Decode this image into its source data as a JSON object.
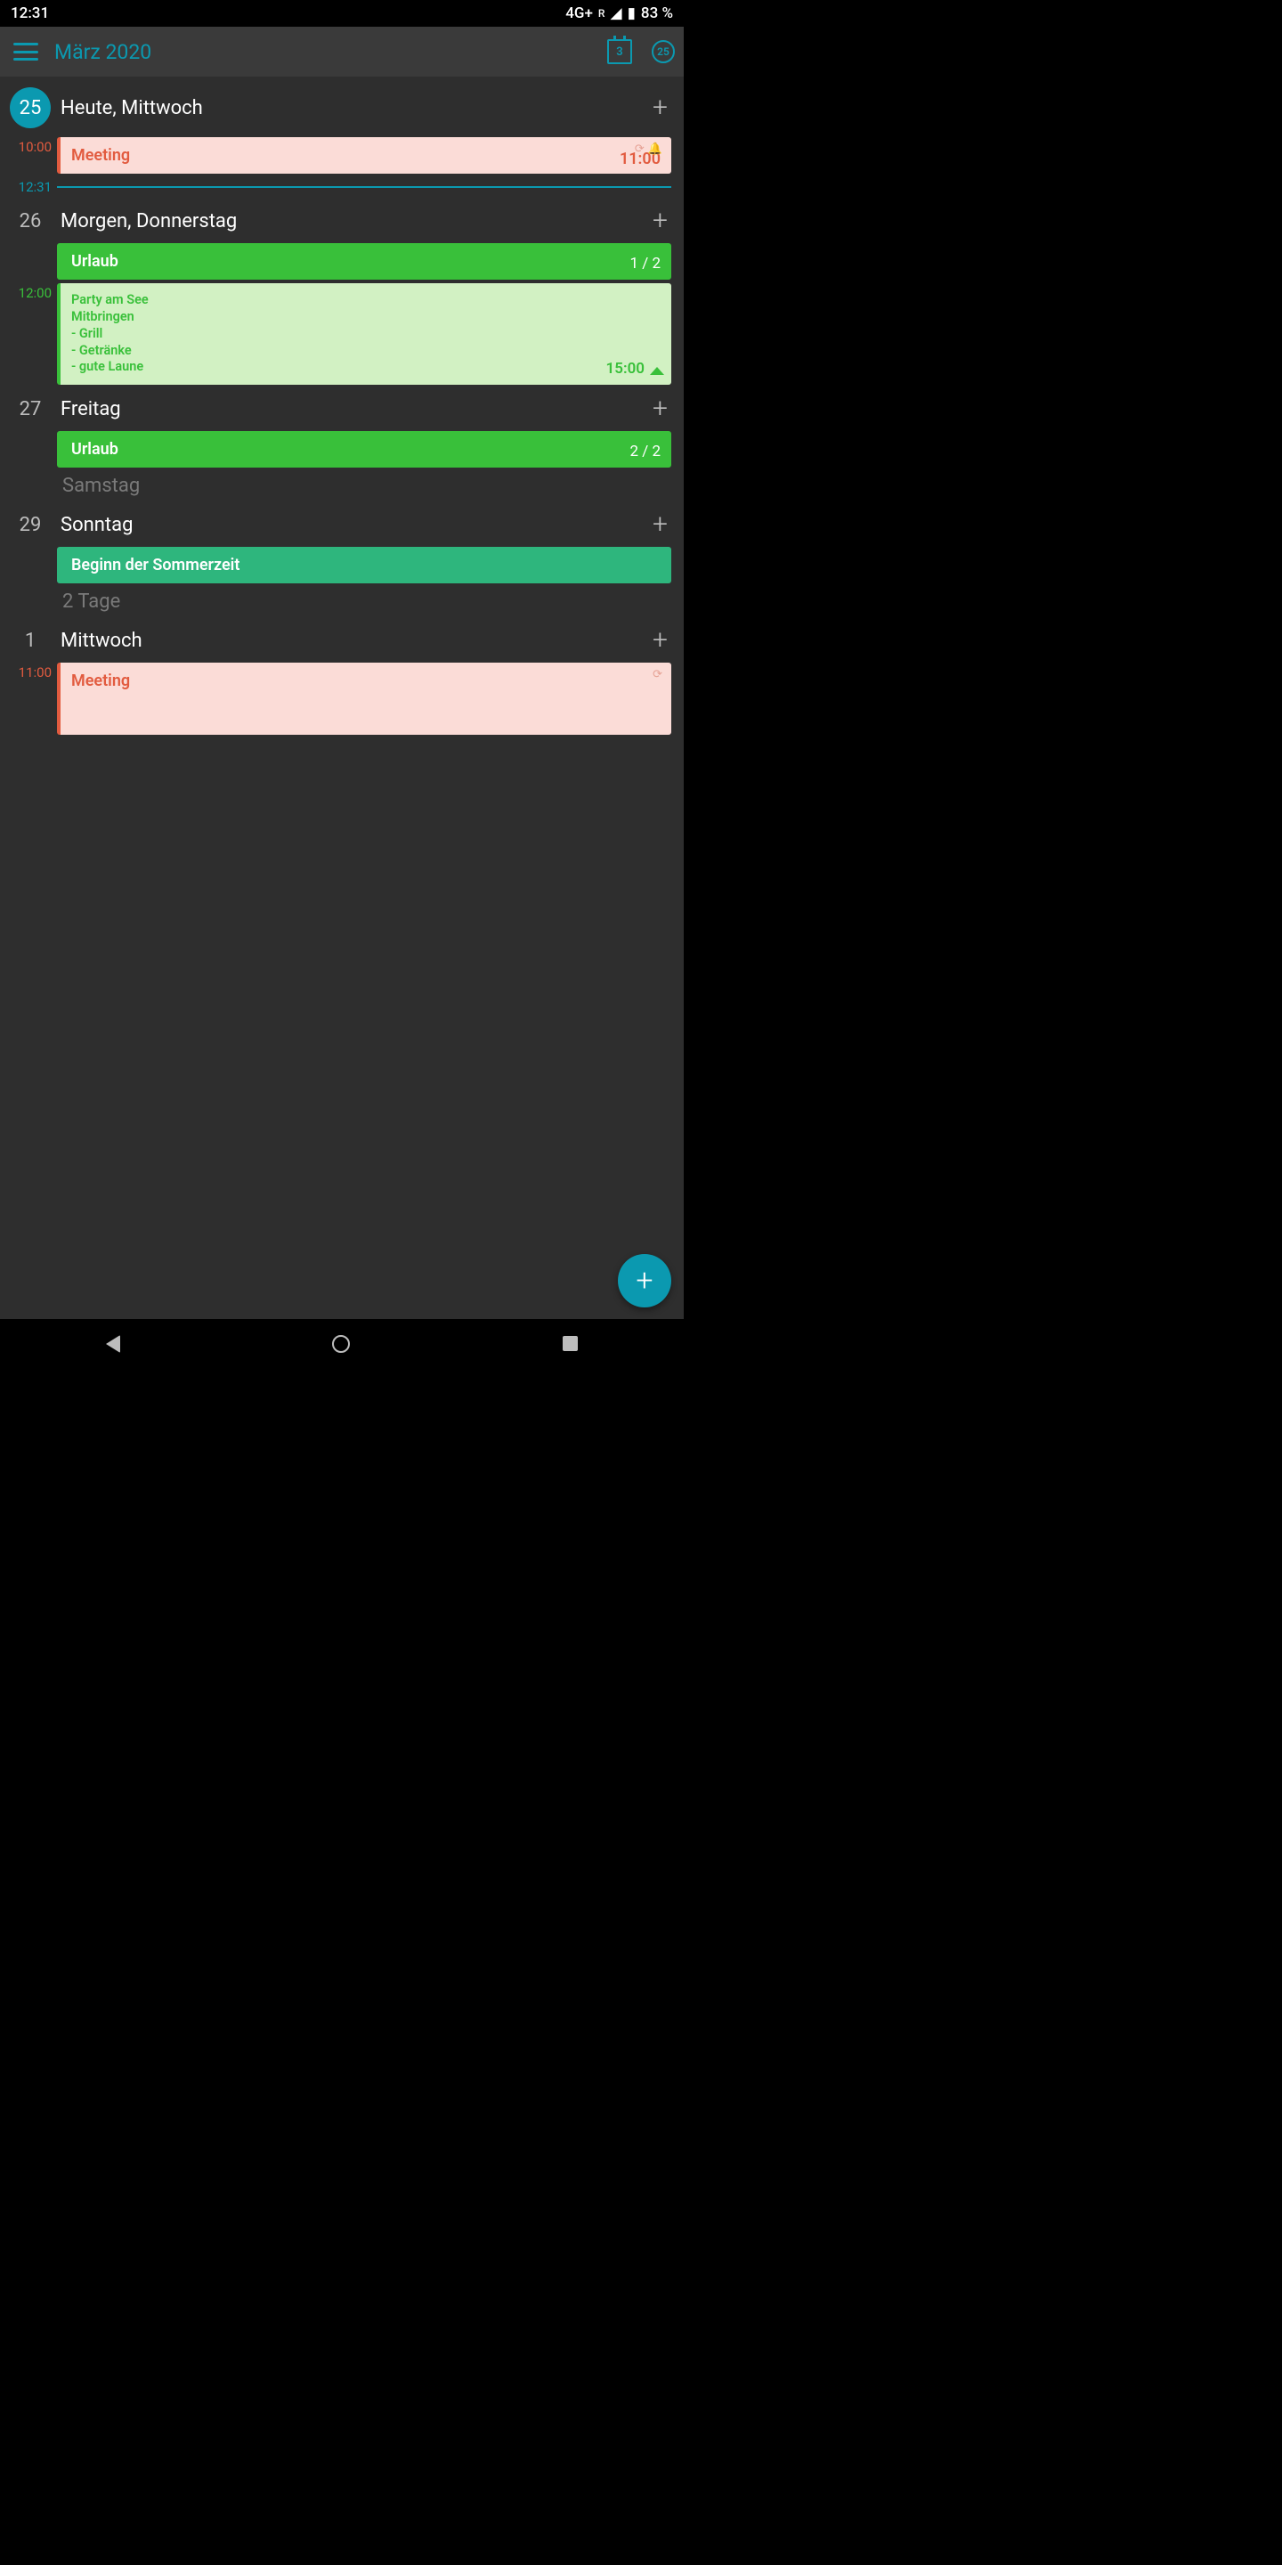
{
  "status": {
    "time": "12:31",
    "network": "4G+",
    "roaming": "R",
    "battery": "83 %"
  },
  "header": {
    "title": "März 2020",
    "cal_day": "3",
    "badge": "25"
  },
  "now": {
    "time": "12:31"
  },
  "days": [
    {
      "num": "25",
      "label": "Heute, Mittwoch",
      "today": true,
      "events": [
        {
          "type": "meeting",
          "start": "10:00",
          "title": "Meeting",
          "end": "11:00",
          "icons": true
        }
      ],
      "show_now": true
    },
    {
      "num": "26",
      "label": "Morgen, Donnerstag",
      "events": [
        {
          "type": "green-solid",
          "title": "Urlaub",
          "counter": "1 / 2"
        },
        {
          "type": "green-light",
          "start": "12:00",
          "lines": [
            "Party am See",
            "Mitbringen",
            "- Grill",
            "- Getränke",
            "- gute Laune"
          ],
          "end": "15:00"
        }
      ]
    },
    {
      "num": "27",
      "label": "Freitag",
      "events": [
        {
          "type": "green-solid",
          "title": "Urlaub",
          "counter": "2 / 2"
        }
      ]
    },
    {
      "label_only": "Samstag"
    },
    {
      "num": "29",
      "label": "Sonntag",
      "events": [
        {
          "type": "teal",
          "title": "Beginn der Sommerzeit"
        }
      ]
    },
    {
      "label_only": "2 Tage"
    },
    {
      "num": "1",
      "label": "Mittwoch",
      "events": [
        {
          "type": "meeting",
          "start": "11:00",
          "title": "Meeting",
          "end": "",
          "icons_refresh_only": true,
          "partial": true
        }
      ]
    }
  ]
}
